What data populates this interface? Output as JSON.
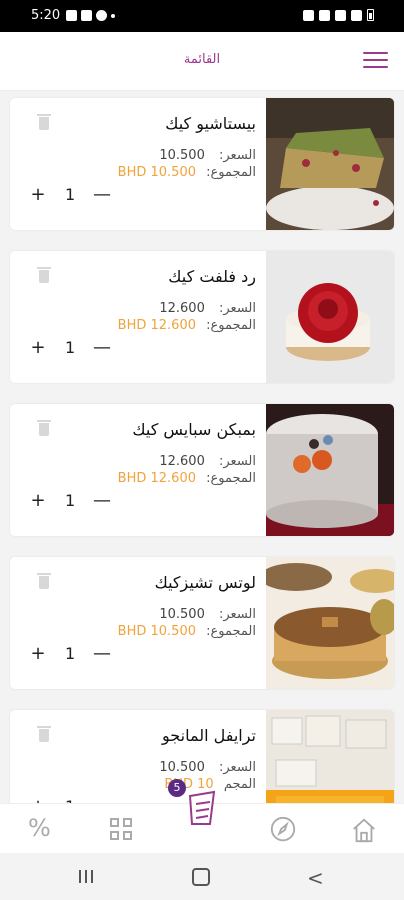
{
  "status_bar": {
    "time": "5:20"
  },
  "header": {
    "title": "القائمة"
  },
  "labels": {
    "price": "السعر:",
    "total": "المجموع:"
  },
  "items": [
    {
      "name": "بيستاشيو كيك",
      "price": "10.500",
      "total": "BHD 10.500",
      "qty": "1"
    },
    {
      "name": "رد فلفت كيك",
      "price": "12.600",
      "total": "BHD 12.600",
      "qty": "1"
    },
    {
      "name": "بمبكن سبايس كيك",
      "price": "12.600",
      "total": "BHD 12.600",
      "qty": "1"
    },
    {
      "name": "لوتس تشيزكيك",
      "price": "10.500",
      "total": "BHD 10.500",
      "qty": "1"
    },
    {
      "name": "ترايفل المانجو",
      "price": "10.500",
      "total": "BHD 10",
      "qty": "1",
      "total_label": "المجم"
    }
  ],
  "cart": {
    "count": "5"
  },
  "colors": {
    "accent": "#9a3a8d",
    "total": "#f0a33a",
    "badge": "#5b2a82"
  },
  "icons": [
    "menu-icon",
    "trash-icon",
    "plus-icon",
    "minus-icon",
    "percent-icon",
    "grid-icon",
    "cart-icon",
    "compass-icon",
    "home-icon"
  ]
}
